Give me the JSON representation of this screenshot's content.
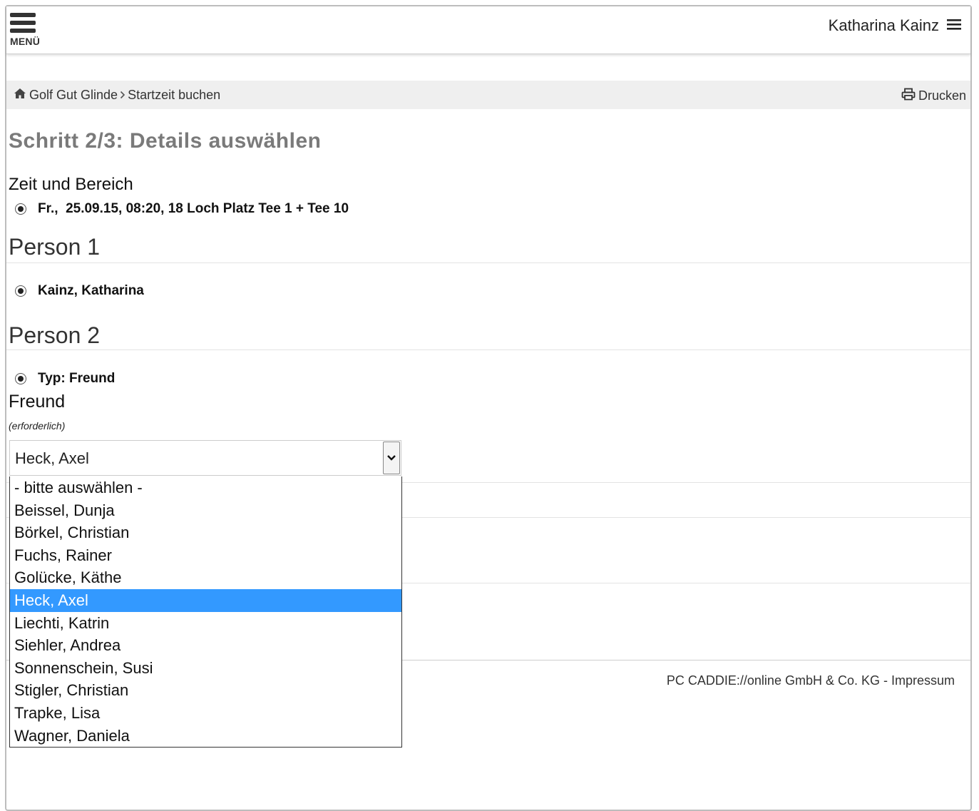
{
  "header": {
    "menu_label": "MENÜ",
    "user_name": "Katharina Kainz"
  },
  "breadcrumb": {
    "items": [
      "Golf Gut Glinde",
      "Startzeit buchen"
    ],
    "print_label": "Drucken"
  },
  "step_title": "Schritt 2/3: Details auswählen",
  "time_section": {
    "label": "Zeit und Bereich",
    "selected": "Fr.,  25.09.15, 08:20, 18 Loch Platz Tee 1 + Tee 10"
  },
  "person1": {
    "heading": "Person 1",
    "selected": "Kainz, Katharina"
  },
  "person2": {
    "heading": "Person 2",
    "type_selected": "Typ: Freund",
    "field_label": "Freund",
    "required_note": "(erforderlich)",
    "select_value": "Heck, Axel",
    "options": [
      "- bitte auswählen -",
      "Beissel, Dunja",
      "Börkel, Christian",
      "Fuchs, Rainer",
      "Golücke, Käthe",
      "Heck, Axel",
      "Liechti, Katrin",
      "Siehler, Andrea",
      "Sonnenschein, Susi",
      "Stigler, Christian",
      "Trapke, Lisa",
      "Wagner, Daniela"
    ],
    "highlighted_index": 5
  },
  "footer": {
    "company": "PC CADDIE://online GmbH & Co. KG",
    "separator": " - ",
    "impressum": "Impressum"
  },
  "colors": {
    "highlight": "#3399ff",
    "title_gray": "#7a7a7a",
    "breadcrumb_bg": "#efefef"
  },
  "icons": {
    "menu": "hamburger-icon",
    "user_menu": "hamburger-icon",
    "home": "home-icon",
    "print": "print-icon",
    "dropdown": "chevron-down-icon"
  }
}
